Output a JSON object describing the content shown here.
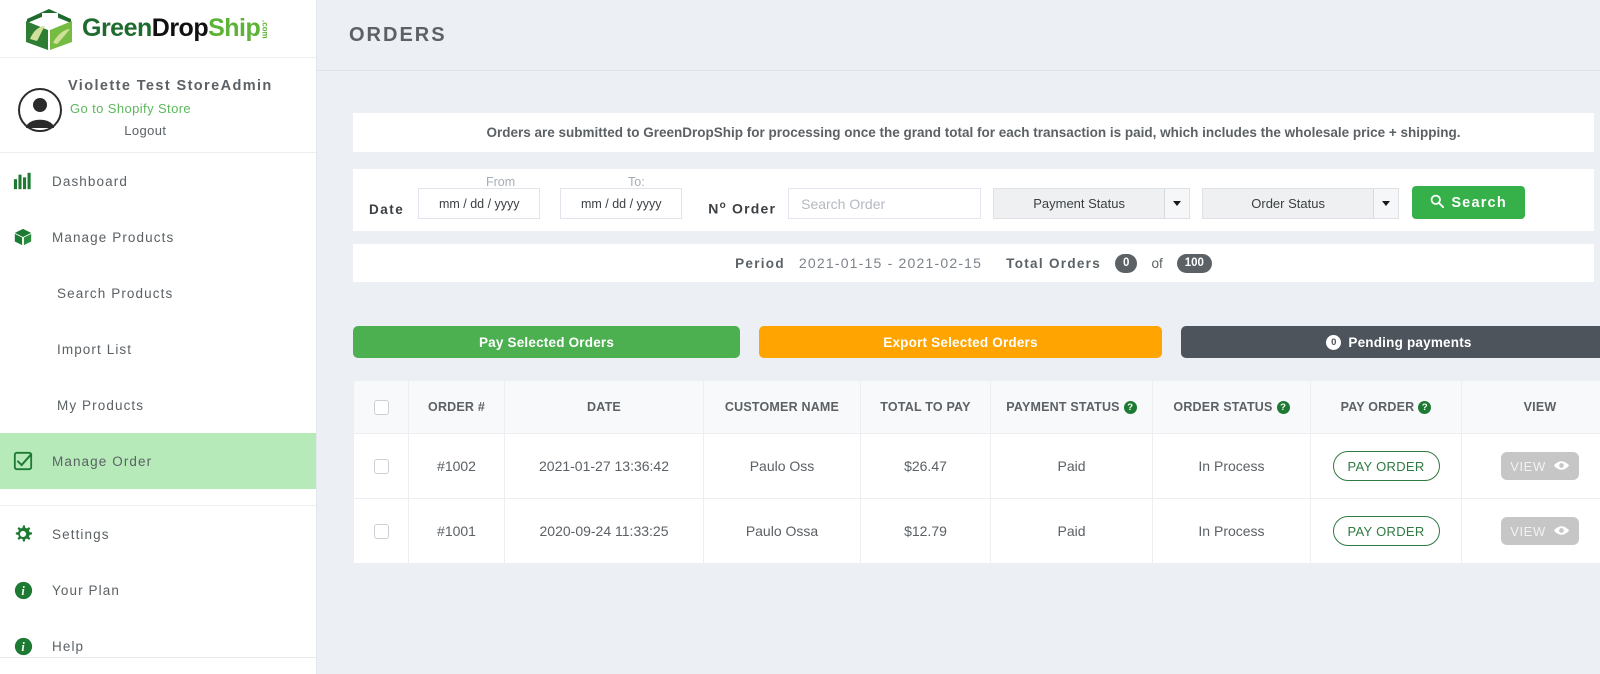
{
  "brand": {
    "name_part1": "Green",
    "name_part2": "Drop",
    "name_part3": "Ship",
    "tld": ".com",
    "logo_icon": "green-box-leaf-logo"
  },
  "user": {
    "name": "Violette Test StoreAdmin",
    "store_link": "Go to Shopify Store",
    "logout": "Logout",
    "avatar_icon": "user-avatar-icon"
  },
  "sidebar": {
    "items": [
      {
        "label": "Dashboard",
        "icon": "bar-chart-icon",
        "active": false,
        "sub": false
      },
      {
        "label": "Manage Products",
        "icon": "box-icon",
        "active": false,
        "sub": false
      },
      {
        "label": "Search Products",
        "icon": "",
        "active": false,
        "sub": true
      },
      {
        "label": "Import List",
        "icon": "",
        "active": false,
        "sub": true
      },
      {
        "label": "My Products",
        "icon": "",
        "active": false,
        "sub": true
      },
      {
        "label": "Manage Order",
        "icon": "checkbox-icon",
        "active": true,
        "sub": false
      },
      {
        "label": "Settings",
        "icon": "gear-icon",
        "active": false,
        "sub": false
      },
      {
        "label": "Your Plan",
        "icon": "info-icon",
        "active": false,
        "sub": false
      },
      {
        "label": "Help",
        "icon": "info-icon",
        "active": false,
        "sub": false
      }
    ]
  },
  "header": {
    "title": "ORDERS"
  },
  "notice": {
    "text": "Orders are submitted to GreenDropShip for processing once the grand total for each transaction is paid, which includes the wholesale price + shipping."
  },
  "filters": {
    "date_label": "Date",
    "from_label": "From",
    "to_label": "To:",
    "date_from_value": "",
    "date_from_placeholder": "mm / dd / yyyy",
    "date_to_value": "",
    "date_to_placeholder": "mm / dd / yyyy",
    "order_label_main": "N",
    "order_label_sup": "o",
    "order_label_rest": " Order",
    "order_search_value": "",
    "order_search_placeholder": "Search Order",
    "payment_status_selected": "Payment Status",
    "order_status_selected": "Order Status",
    "search_button": "Search",
    "search_icon": "search-icon"
  },
  "period": {
    "period_label": "Period",
    "period_value": "2021-01-15 - 2021-02-15",
    "total_label": "Total Orders",
    "total_shown": "0",
    "of_label": "of",
    "total_count": "100"
  },
  "actions": {
    "pay_selected": "Pay Selected Orders",
    "export_selected": "Export Selected Orders",
    "pending_payments": "Pending payments",
    "pending_count": "0"
  },
  "table": {
    "columns": [
      {
        "label": "",
        "help": false
      },
      {
        "label": "ORDER #",
        "help": false
      },
      {
        "label": "DATE",
        "help": false
      },
      {
        "label": "CUSTOMER NAME",
        "help": false
      },
      {
        "label": "TOTAL TO PAY",
        "help": false
      },
      {
        "label": "PAYMENT STATUS",
        "help": true
      },
      {
        "label": "ORDER STATUS",
        "help": true
      },
      {
        "label": "PAY ORDER",
        "help": true
      },
      {
        "label": "VIEW",
        "help": false
      }
    ],
    "help_glyph": "?",
    "pay_order_label": "PAY ORDER",
    "view_label": "VIEW",
    "view_icon": "eye-icon",
    "rows": [
      {
        "order_no": "#1002",
        "date": "2021-01-27 13:36:42",
        "customer": "Paulo Oss",
        "total": "$26.47",
        "payment_status": "Paid",
        "order_status": "In Process"
      },
      {
        "order_no": "#1001",
        "date": "2020-09-24 11:33:25",
        "customer": "Paulo Ossa",
        "total": "$12.79",
        "payment_status": "Paid",
        "order_status": "In Process"
      }
    ]
  },
  "colors": {
    "brand_green": "#1d6b2e",
    "accent_green": "#5cb335",
    "search_green": "#36b14a",
    "pay_green": "#4caf50",
    "export_orange": "#ffa400",
    "pending_slate": "#4d545c",
    "active_nav": "#b6ebb9",
    "page_bg": "#eceff4"
  }
}
